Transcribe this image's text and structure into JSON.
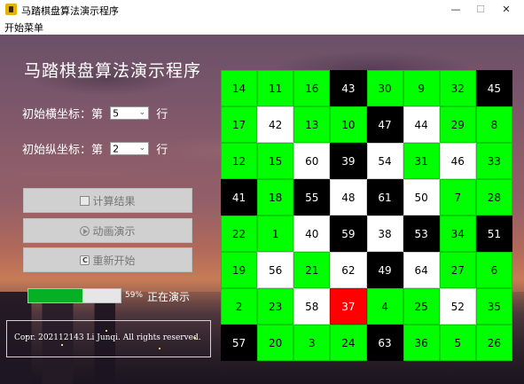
{
  "window": {
    "title": "马踏棋盘算法演示程序",
    "min_label": "—",
    "max_label": "☐",
    "close_label": "✕"
  },
  "menu": {
    "start_menu_label": "开始菜单"
  },
  "heading": "马踏棋盘算法演示程序",
  "start_x": {
    "prefix": "初始横坐标：第",
    "value": "5",
    "suffix": "行"
  },
  "start_y": {
    "prefix": "初始纵坐标：第",
    "value": "2",
    "suffix": "行"
  },
  "buttons": {
    "calculate": "计算结果",
    "animate": "动画演示",
    "restart": "重新开始"
  },
  "progress": {
    "percent": 59,
    "label": "59%",
    "status": "正在演示"
  },
  "copyright": "Copr. 202112143 Li Junqi. All rights reserved.",
  "colors": {
    "visited": "#00ff00",
    "unvisited_light": "#ffffff",
    "unvisited_dark": "#000000",
    "current": "#ff0000",
    "progress": "#06b025"
  },
  "board": [
    [
      {
        "n": "14",
        "c": "g"
      },
      {
        "n": "11",
        "c": "g"
      },
      {
        "n": "16",
        "c": "g"
      },
      {
        "n": "43",
        "c": "b"
      },
      {
        "n": "30",
        "c": "g"
      },
      {
        "n": "9",
        "c": "g"
      },
      {
        "n": "32",
        "c": "g"
      },
      {
        "n": "45",
        "c": "b"
      }
    ],
    [
      {
        "n": "17",
        "c": "g"
      },
      {
        "n": "42",
        "c": "w"
      },
      {
        "n": "13",
        "c": "g"
      },
      {
        "n": "10",
        "c": "g"
      },
      {
        "n": "47",
        "c": "b"
      },
      {
        "n": "44",
        "c": "w"
      },
      {
        "n": "29",
        "c": "g"
      },
      {
        "n": "8",
        "c": "g"
      }
    ],
    [
      {
        "n": "12",
        "c": "g"
      },
      {
        "n": "15",
        "c": "g"
      },
      {
        "n": "60",
        "c": "w"
      },
      {
        "n": "39",
        "c": "b"
      },
      {
        "n": "54",
        "c": "w"
      },
      {
        "n": "31",
        "c": "g"
      },
      {
        "n": "46",
        "c": "w"
      },
      {
        "n": "33",
        "c": "g"
      }
    ],
    [
      {
        "n": "41",
        "c": "b"
      },
      {
        "n": "18",
        "c": "g"
      },
      {
        "n": "55",
        "c": "b"
      },
      {
        "n": "48",
        "c": "w"
      },
      {
        "n": "61",
        "c": "b"
      },
      {
        "n": "50",
        "c": "w"
      },
      {
        "n": "7",
        "c": "g"
      },
      {
        "n": "28",
        "c": "g"
      }
    ],
    [
      {
        "n": "22",
        "c": "g"
      },
      {
        "n": "1",
        "c": "g"
      },
      {
        "n": "40",
        "c": "w"
      },
      {
        "n": "59",
        "c": "b"
      },
      {
        "n": "38",
        "c": "w"
      },
      {
        "n": "53",
        "c": "b"
      },
      {
        "n": "34",
        "c": "g"
      },
      {
        "n": "51",
        "c": "b"
      }
    ],
    [
      {
        "n": "19",
        "c": "g"
      },
      {
        "n": "56",
        "c": "w"
      },
      {
        "n": "21",
        "c": "g"
      },
      {
        "n": "62",
        "c": "w"
      },
      {
        "n": "49",
        "c": "b"
      },
      {
        "n": "64",
        "c": "w"
      },
      {
        "n": "27",
        "c": "g"
      },
      {
        "n": "6",
        "c": "g"
      }
    ],
    [
      {
        "n": "2",
        "c": "g"
      },
      {
        "n": "23",
        "c": "g"
      },
      {
        "n": "58",
        "c": "w"
      },
      {
        "n": "37",
        "c": "r"
      },
      {
        "n": "4",
        "c": "g"
      },
      {
        "n": "25",
        "c": "g"
      },
      {
        "n": "52",
        "c": "w"
      },
      {
        "n": "35",
        "c": "g"
      }
    ],
    [
      {
        "n": "57",
        "c": "b"
      },
      {
        "n": "20",
        "c": "g"
      },
      {
        "n": "3",
        "c": "g"
      },
      {
        "n": "24",
        "c": "g"
      },
      {
        "n": "63",
        "c": "b"
      },
      {
        "n": "36",
        "c": "g"
      },
      {
        "n": "5",
        "c": "g"
      },
      {
        "n": "26",
        "c": "g"
      }
    ]
  ]
}
